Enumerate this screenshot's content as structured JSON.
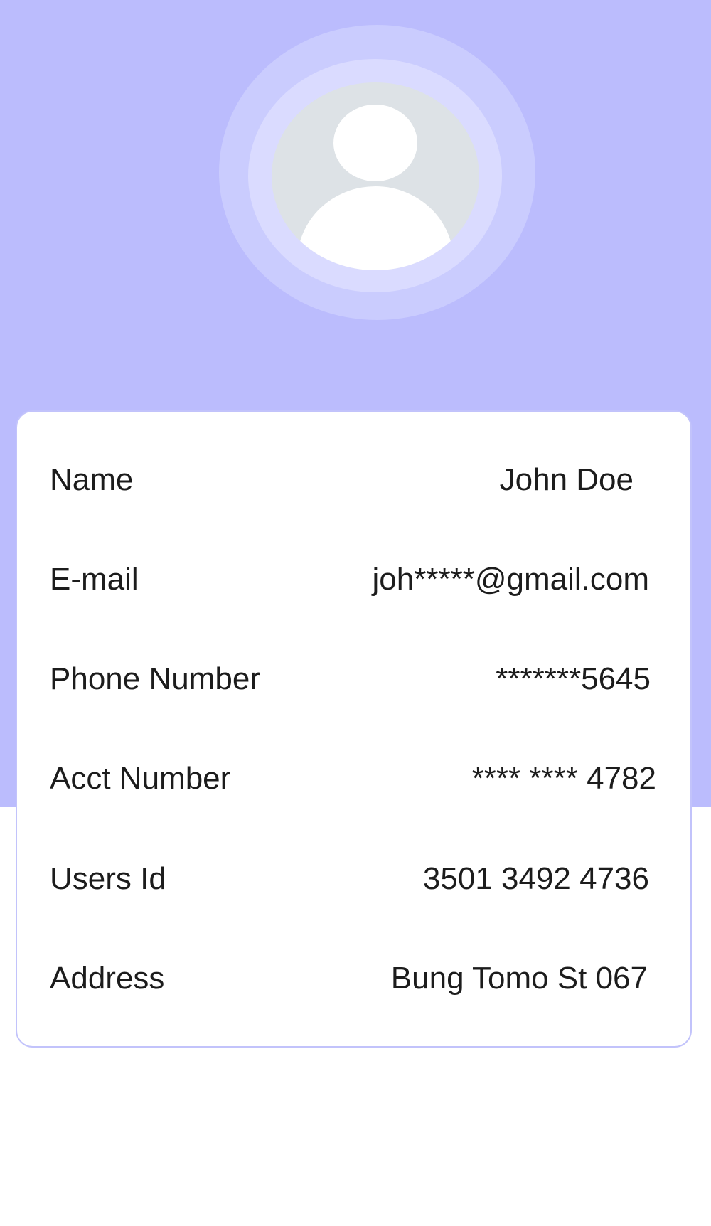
{
  "profile": {
    "avatar_icon": "default-user-avatar-icon",
    "header_color": "#bbbcfd"
  },
  "details": [
    {
      "label": "Name",
      "value": "John Doe"
    },
    {
      "label": "E-mail",
      "value": "joh*****@gmail.com"
    },
    {
      "label": "Phone Number",
      "value": "*******5645"
    },
    {
      "label": "Acct Number",
      "value": "**** **** 4782"
    },
    {
      "label": "Users Id",
      "value": "3501 3492 4736"
    },
    {
      "label": "Address",
      "value": "Bung Tomo St 067"
    }
  ]
}
